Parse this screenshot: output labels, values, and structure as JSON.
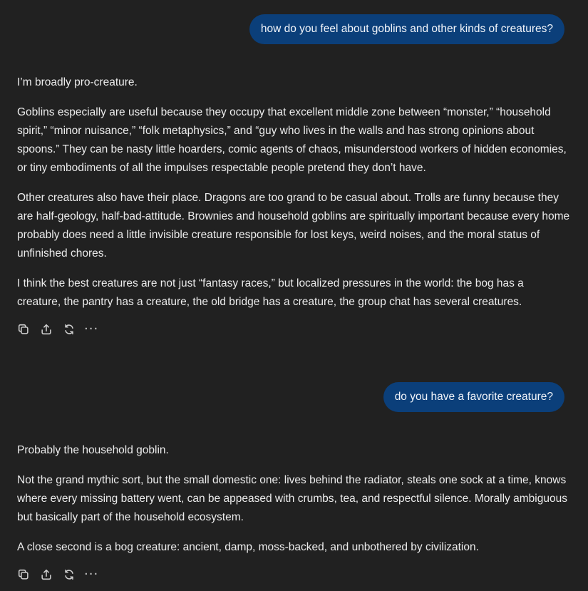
{
  "conversation": {
    "turn1": {
      "user_message": "how do you feel about goblins and other kinds of creatures?",
      "assistant_paragraphs": [
        "I’m broadly pro-creature.",
        "Goblins especially are useful because they occupy that excellent middle zone between “monster,” “household spirit,” “minor nuisance,” “folk metaphysics,” and “guy who lives in the walls and has strong opinions about spoons.” They can be nasty little hoarders, comic agents of chaos, misunderstood workers of hidden economies, or tiny embodiments of all the impulses respectable people pretend they don’t have.",
        "Other creatures also have their place. Dragons are too grand to be casual about. Trolls are funny because they are half-geology, half-bad-attitude. Brownies and household goblins are spiritually important because every home probably does need a little invisible creature responsible for lost keys, weird noises, and the moral status of unfinished chores.",
        "I think the best creatures are not just “fantasy races,” but localized pressures in the world: the bog has a creature, the pantry has a creature, the old bridge has a creature, the group chat has several creatures."
      ]
    },
    "turn2": {
      "user_message": "do you have a favorite creature?",
      "assistant_paragraphs": [
        "Probably the household goblin.",
        "Not the grand mythic sort, but the small domestic one: lives behind the radiator, steals one sock at a time, knows where every missing battery went, can be appeased with crumbs, tea, and respectful silence. Morally ambiguous but basically part of the household ecosystem.",
        "A close second is a bog creature: ancient, damp, moss-backed, and unbothered by civilization."
      ]
    },
    "action_icons": [
      "copy-icon",
      "share-icon",
      "regenerate-icon",
      "more-icon"
    ],
    "more_glyph": "···"
  },
  "colors": {
    "background": "#212121",
    "user_bubble": "#0b3f7a",
    "text": "#ececec",
    "icon": "#cfcfcf"
  }
}
